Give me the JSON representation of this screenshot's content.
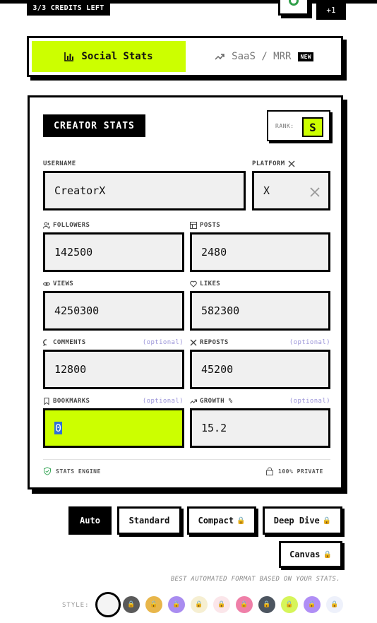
{
  "top": {
    "credits": "3/3 CREDITS LEFT",
    "right_btn_text": "+1"
  },
  "tabs": [
    {
      "label": "Social Stats",
      "icon": "bar-chart-icon",
      "active": true
    },
    {
      "label": "SaaS / MRR",
      "icon": "trending-up-icon",
      "badge": "NEW",
      "active": false
    }
  ],
  "card": {
    "title": "CREATOR STATS",
    "rank_label": "RANK:",
    "rank_value": "S",
    "fields": {
      "username": {
        "label": "USERNAME",
        "value": "CreatorX"
      },
      "platform": {
        "label": "PLATFORM",
        "value": "X"
      },
      "followers": {
        "label": "FOLLOWERS",
        "value": "142500"
      },
      "posts": {
        "label": "POSTS",
        "value": "2480"
      },
      "views": {
        "label": "VIEWS",
        "value": "4250300"
      },
      "likes": {
        "label": "LIKES",
        "value": "582300"
      },
      "comments": {
        "label": "COMMENTS",
        "value": "12800",
        "optional": "(optional)"
      },
      "reposts": {
        "label": "REPOSTS",
        "value": "45200",
        "optional": "(optional)"
      },
      "bookmarks": {
        "label": "BOOKMARKS",
        "value": "0",
        "optional": "(optional)"
      },
      "growth": {
        "label": "GROWTH %",
        "value": "15.2",
        "optional": "(optional)"
      }
    },
    "footer_left": "STATS ENGINE",
    "footer_right": "100% PRIVATE"
  },
  "formats": [
    {
      "label": "Auto",
      "active": true,
      "locked": false
    },
    {
      "label": "Standard",
      "active": false,
      "locked": false
    },
    {
      "label": "Compact",
      "active": false,
      "locked": true
    },
    {
      "label": "Deep Dive",
      "active": false,
      "locked": true
    },
    {
      "label": "Canvas",
      "active": false,
      "locked": true
    }
  ],
  "hint": "BEST AUTOMATED FORMAT BASED ON YOUR STATS.",
  "style_label": "STYLE:",
  "colors": {
    "accent": "#ccff00",
    "black": "#000000",
    "field_bg": "#f0f0f0",
    "optional_text": "#9a93d8"
  },
  "swatches": [
    "#f4f4f4",
    "#5a5a5a",
    "#e8b64a",
    "#a98cf0",
    "#f6efd2",
    "#fbe6ea",
    "#ef7fa8",
    "#4c5560",
    "#d6f55a",
    "#b08ef5",
    "#eef1fb"
  ]
}
